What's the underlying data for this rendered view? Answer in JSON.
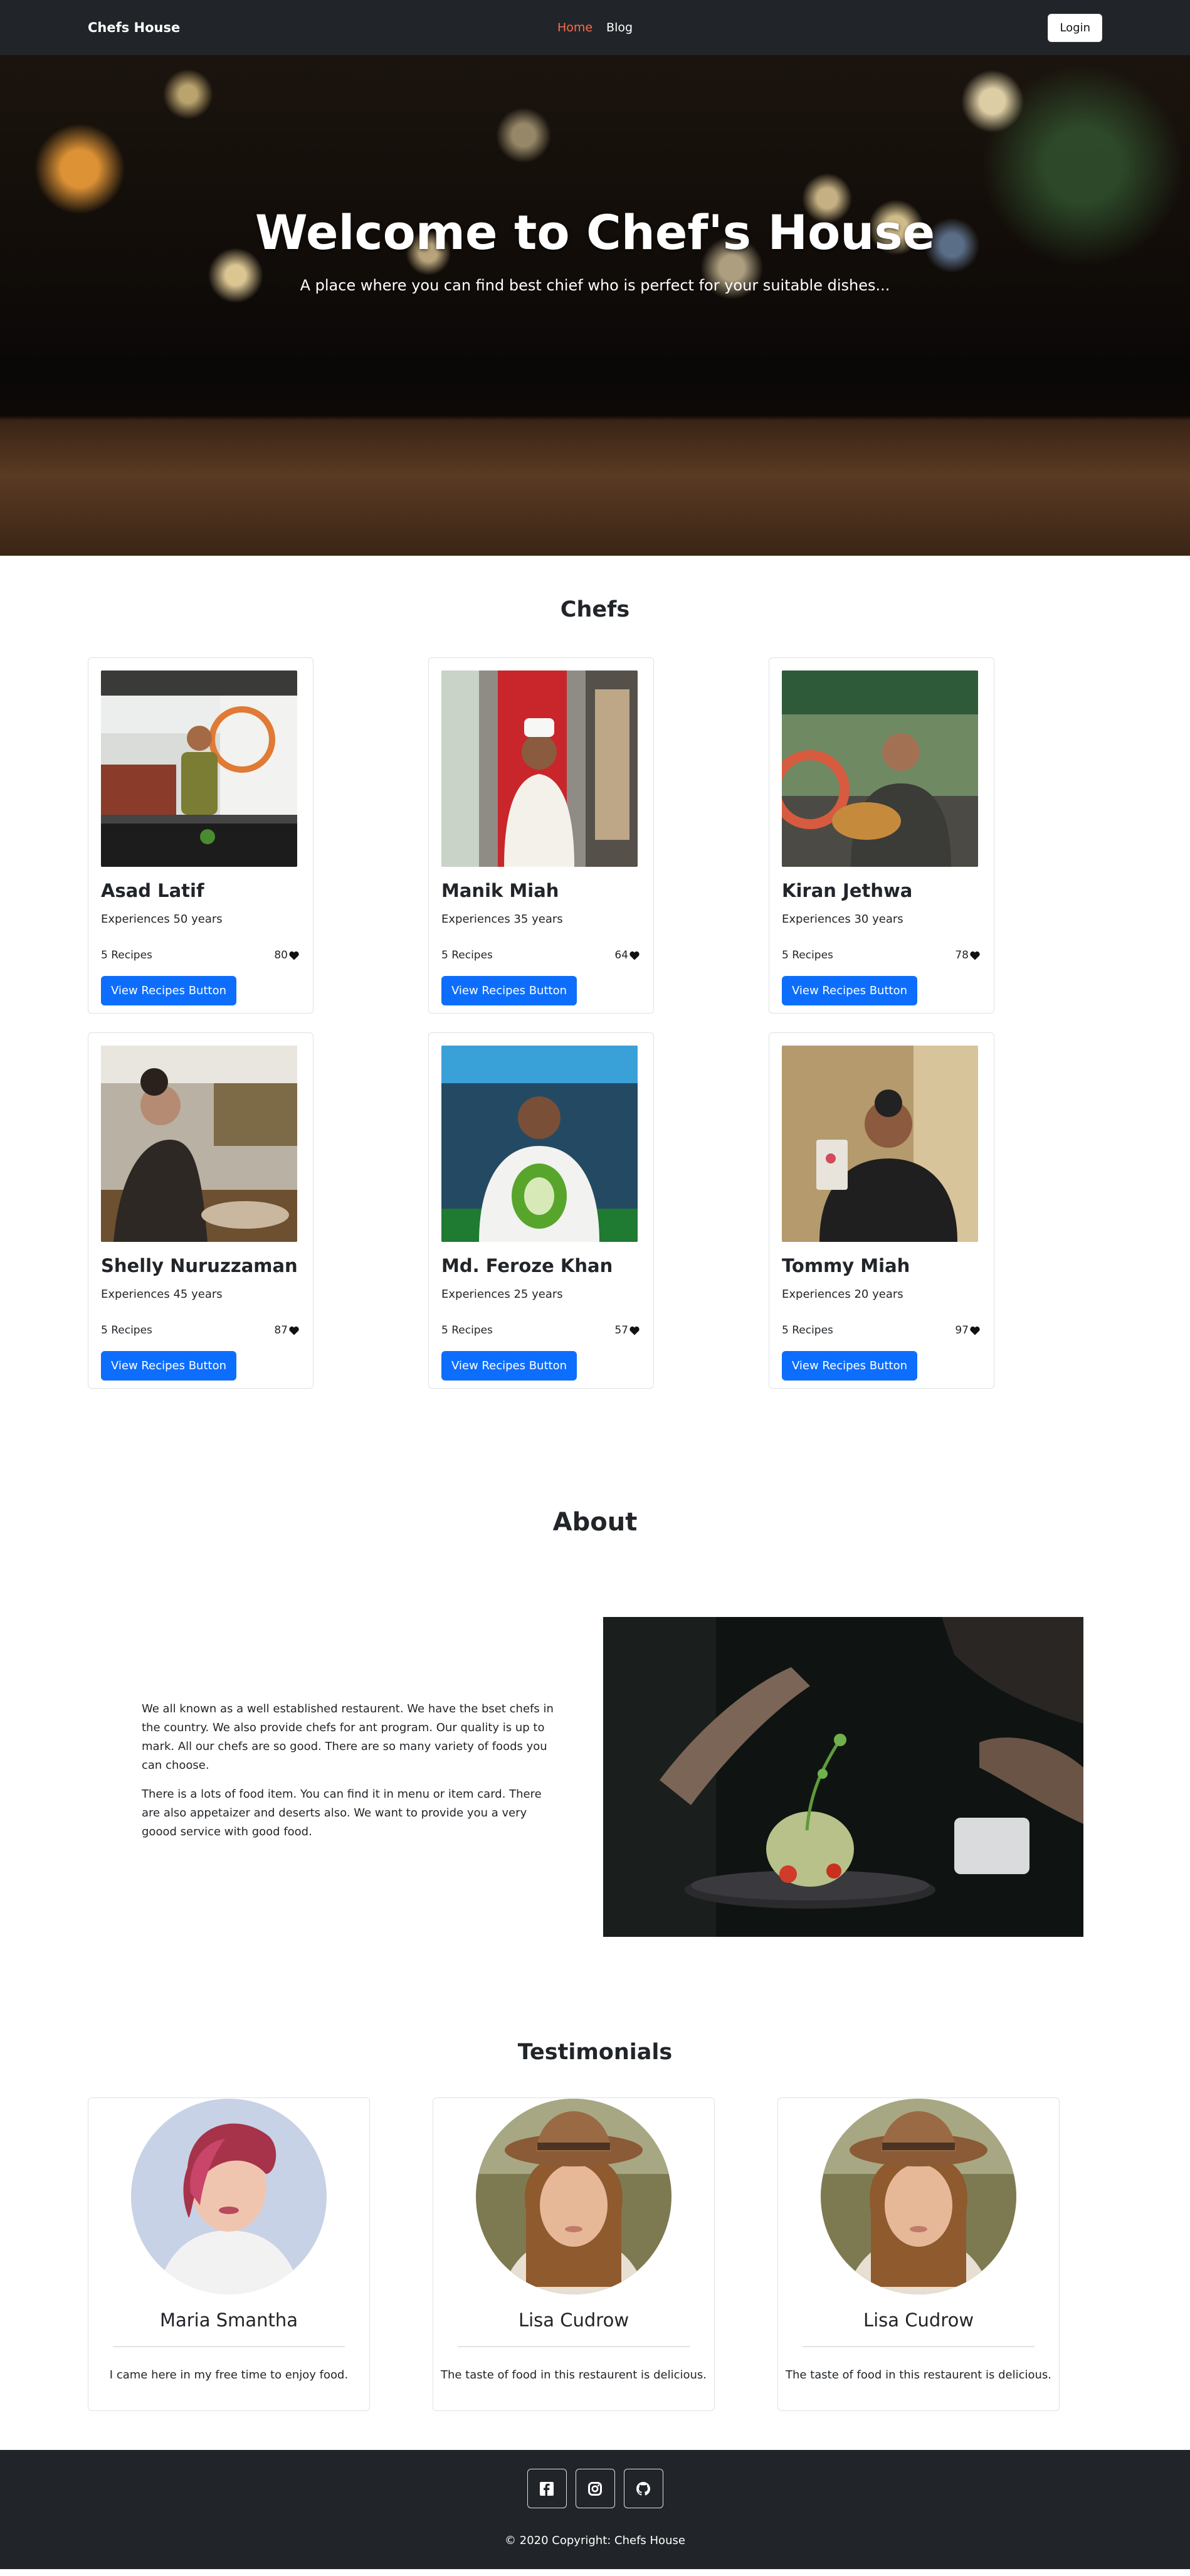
{
  "navbar": {
    "brand": "Chefs House",
    "links": [
      {
        "label": "Home",
        "active": true
      },
      {
        "label": "Blog",
        "active": false
      }
    ],
    "login_label": "Login"
  },
  "hero": {
    "title": "Welcome to Chef's House",
    "subtitle": "A place where you can find best chief who is perfect for your suitable dishes..."
  },
  "chefs": {
    "title": "Chefs",
    "items": [
      {
        "name": "Asad Latif",
        "experience": "Experiences 50 years",
        "recipes": "5 Recipes",
        "likes": "80",
        "button": "View Recipes Button"
      },
      {
        "name": "Manik Miah",
        "experience": "Experiences 35 years",
        "recipes": "5 Recipes",
        "likes": "64",
        "button": "View Recipes Button"
      },
      {
        "name": "Kiran Jethwa",
        "experience": "Experiences 30 years",
        "recipes": "5 Recipes",
        "likes": "78",
        "button": "View Recipes Button"
      },
      {
        "name": "Shelly Nuruzzaman",
        "experience": "Experiences 45 years",
        "recipes": "5 Recipes",
        "likes": "87",
        "button": "View Recipes Button"
      },
      {
        "name": "Md. Feroze Khan",
        "experience": "Experiences 25 years",
        "recipes": "5 Recipes",
        "likes": "57",
        "button": "View Recipes Button"
      },
      {
        "name": "Tommy Miah",
        "experience": "Experiences 20 years",
        "recipes": "5 Recipes",
        "likes": "97",
        "button": "View Recipes Button"
      }
    ]
  },
  "about": {
    "title": "About",
    "paragraphs": [
      "We all known as a well established restaurent. We have the bset chefs in the country. We also provide chefs for ant program. Our quality is up to mark. All our chefs are so good. There are so many variety of foods you can choose.",
      "There is a lots of food item. You can find it in menu or item card. There are also appetaizer and deserts also. We want to provide you a very goood service with good food."
    ]
  },
  "testimonials": {
    "title": "Testimonials",
    "items": [
      {
        "name": "Maria Smantha",
        "quote": "I came here in my free time to enjoy food."
      },
      {
        "name": "Lisa Cudrow",
        "quote": "The taste of food in this restaurent is delicious."
      },
      {
        "name": "Lisa Cudrow",
        "quote": "The taste of food in this restaurent is delicious."
      }
    ]
  },
  "footer": {
    "social": [
      {
        "icon": "facebook-icon"
      },
      {
        "icon": "instagram-icon"
      },
      {
        "icon": "github-icon"
      }
    ],
    "copyright": "© 2020 Copyright: Chefs House"
  },
  "colors": {
    "dark": "#212529",
    "primary": "#0d6efd",
    "nav_active": "#ff6b4a"
  }
}
